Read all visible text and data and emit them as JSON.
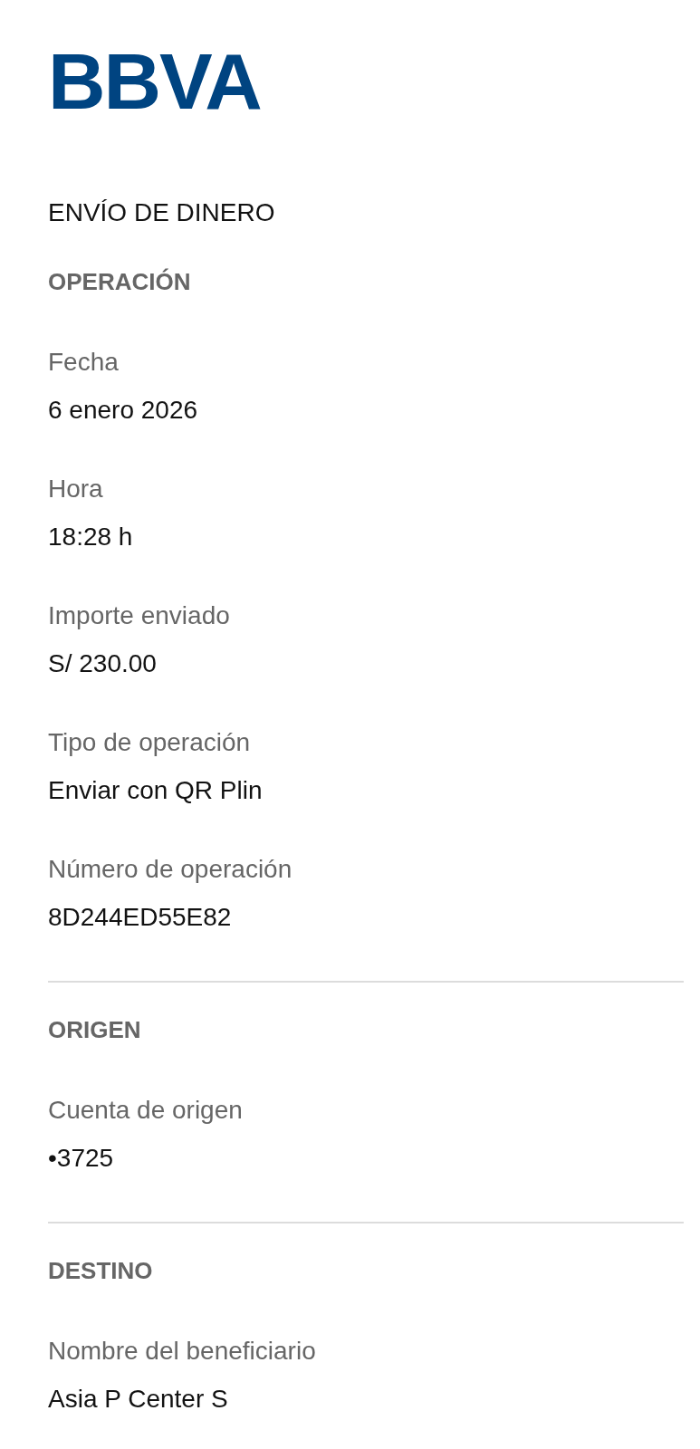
{
  "logo": "BBVA",
  "title": "ENVÍO DE DINERO",
  "sections": [
    {
      "heading": "OPERACIÓN",
      "fields": [
        {
          "label": "Fecha",
          "value": "6 enero 2026"
        },
        {
          "label": "Hora",
          "value": "18:28 h"
        },
        {
          "label": "Importe enviado",
          "value": "S/ 230.00"
        },
        {
          "label": "Tipo de operación",
          "value": "Enviar con QR Plin"
        },
        {
          "label": "Número de operación",
          "value": "8D244ED55E82"
        }
      ]
    },
    {
      "heading": "ORIGEN",
      "fields": [
        {
          "label": "Cuenta de origen",
          "value": "•3725"
        }
      ]
    },
    {
      "heading": "DESTINO",
      "fields": [
        {
          "label": "Nombre del beneficiario",
          "value": "Asia P Center S"
        }
      ]
    }
  ]
}
